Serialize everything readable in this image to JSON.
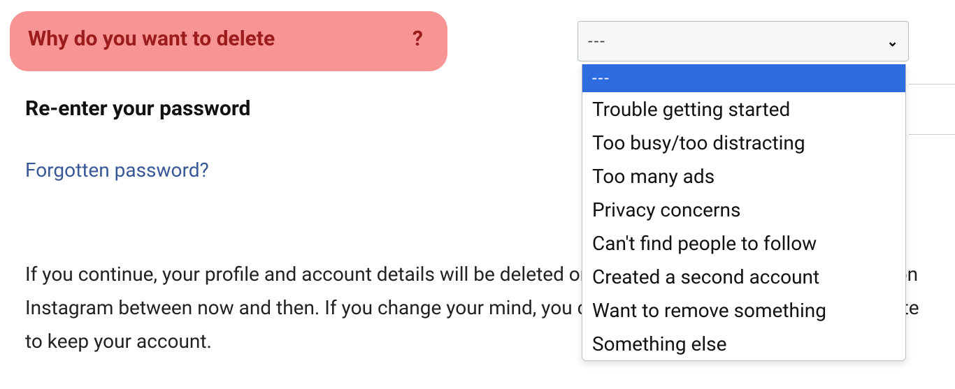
{
  "question": {
    "text": "Why do you want to delete",
    "mark": "?"
  },
  "reenter_label": "Re-enter your password",
  "forgot_password": "Forgotten password?",
  "paragraph": "If you continue, your profile and account details will be deleted on 29 April 2023. You won't be visible on Instagram between now and then. If you change your mind, you can log back in before the deletion date to keep your account.",
  "select": {
    "value": "---",
    "options": [
      "---",
      "Trouble getting started",
      "Too busy/too distracting",
      "Too many ads",
      "Privacy concerns",
      "Can't find people to follow",
      "Created a second account",
      "Want to remove something",
      "Something else"
    ]
  }
}
